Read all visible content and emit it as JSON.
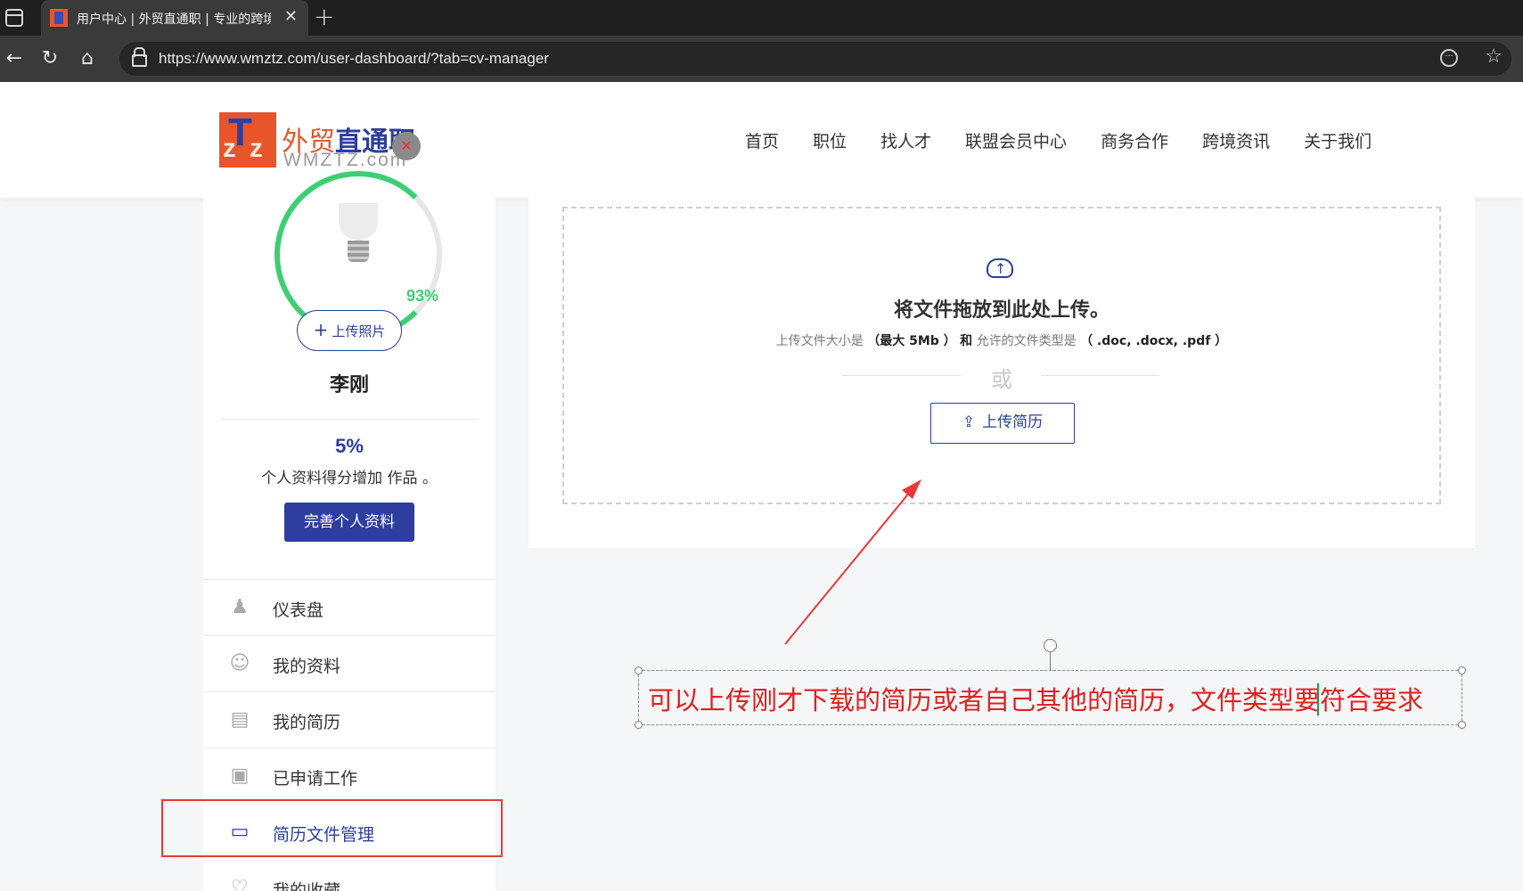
{
  "browser": {
    "tab_title": "用户中心 | 外贸直通职 | 专业的跨境",
    "url": "https://www.wmztz.com/user-dashboard/?tab=cv-manager"
  },
  "site": {
    "logo_cn_a": "外贸",
    "logo_cn_b": "直通职",
    "logo_en": "WMZTZ.com",
    "nav": [
      "首页",
      "职位",
      "找人才",
      "联盟会员中心",
      "商务合作",
      "跨境资讯",
      "关于我们"
    ]
  },
  "profile": {
    "completion": "93%",
    "completion_value": 0.93,
    "upload_photo_label": "上传照片",
    "name": "李刚",
    "score_percent": "5%",
    "score_text": "个人资料得分增加 作品 。",
    "complete_button": "完善个人资料"
  },
  "menu": [
    {
      "label": "仪表盘",
      "icon": "dashboard-icon"
    },
    {
      "label": "我的资料",
      "icon": "user-icon"
    },
    {
      "label": "我的简历",
      "icon": "resume-icon"
    },
    {
      "label": "已申请工作",
      "icon": "briefcase-icon"
    },
    {
      "label": "简历文件管理",
      "icon": "id-card-icon",
      "active": true
    },
    {
      "label": "我的收藏",
      "icon": "heart-icon"
    }
  ],
  "upload": {
    "title": "将文件拖放到此处上传。",
    "hint_a": "上传文件大小是",
    "hint_size": "（最大 5Mb ）",
    "hint_and": "和",
    "hint_b": "允许的文件类型是",
    "hint_types": "（ .doc, .docx, .pdf ）",
    "or": "或",
    "button": "上传简历"
  },
  "annotation": {
    "text": "可以上传刚才下载的简历或者自己其他的简历，文件类型要符合要求",
    "color": "#e02020"
  },
  "colors": {
    "brand_blue": "#2d3e9e",
    "brand_orange": "#e8552b",
    "progress_green": "#3ccf73"
  }
}
